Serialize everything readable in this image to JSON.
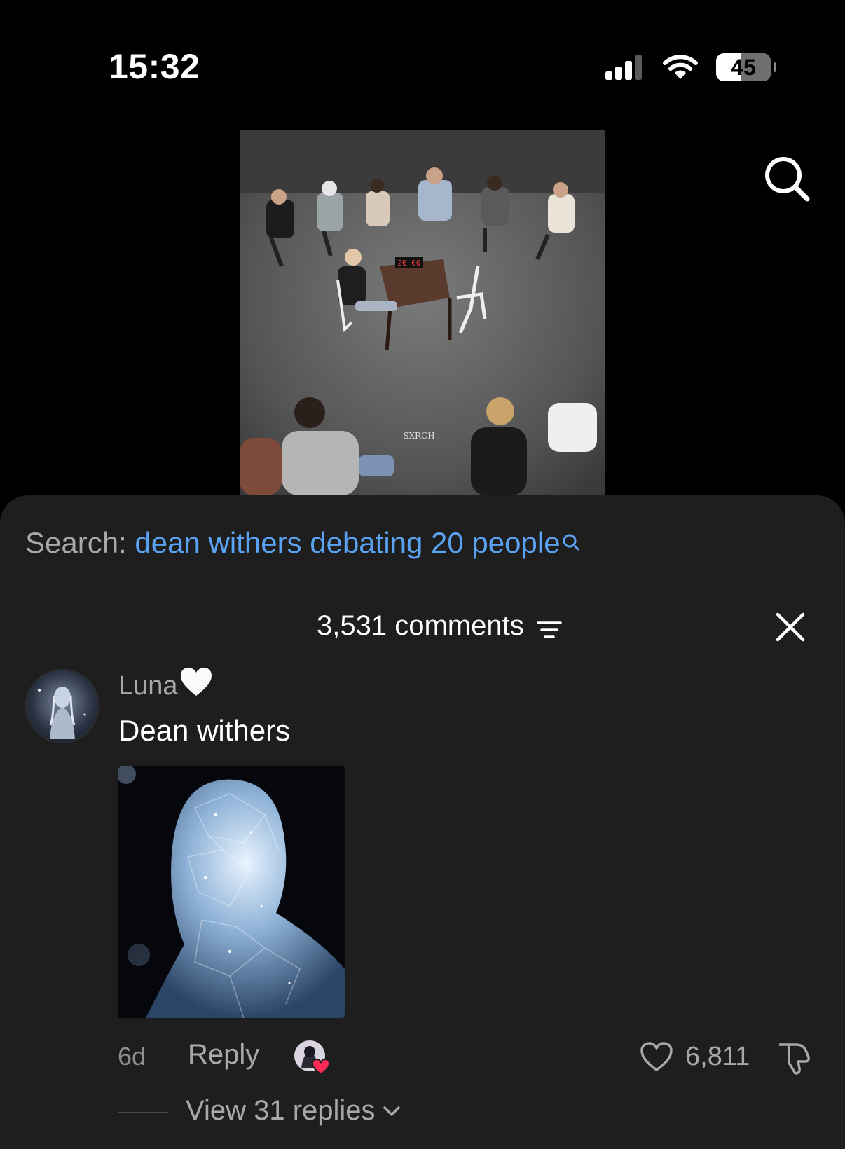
{
  "status_bar": {
    "time": "15:32",
    "battery": "45",
    "battery_level": 0.45
  },
  "video": {
    "timer_text": "20 00",
    "watermark": "SXRCH"
  },
  "comments_sheet": {
    "search_label": "Search:",
    "search_query": "dean withers debating 20 people",
    "comments_count": "3,531 comments"
  },
  "comment": {
    "username": "Luna",
    "text": "Dean withers",
    "age": "6d",
    "reply_label": "Reply",
    "like_count": "6,811",
    "view_replies": "View 31 replies"
  },
  "colors": {
    "sheet_bg": "#1e1e1f",
    "link_blue": "#5aa3f2",
    "secondary_text": "#a8a8ab",
    "creator_heart": "#fe2c55"
  }
}
